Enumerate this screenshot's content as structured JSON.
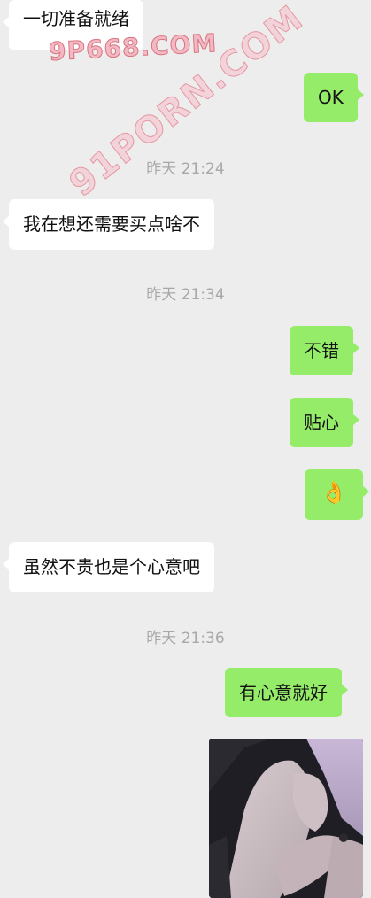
{
  "messages": [
    {
      "side": "in",
      "text": "一切准备就绪"
    },
    {
      "side": "out",
      "text": "OK"
    },
    {
      "timestamp": "昨天 21:24"
    },
    {
      "side": "in",
      "text": "我在想还需要买点啥不"
    },
    {
      "timestamp": "昨天 21:34"
    },
    {
      "side": "out",
      "text": "不错"
    },
    {
      "side": "out",
      "text": "贴心"
    },
    {
      "side": "out",
      "emoji": "ok-hand-emoji",
      "text": "👌"
    },
    {
      "side": "in",
      "text": "虽然不贵也是个心意吧"
    },
    {
      "timestamp": "昨天 21:36"
    },
    {
      "side": "out",
      "text": "有心意就好"
    },
    {
      "side": "out",
      "image": "photo-message"
    }
  ],
  "watermarks": {
    "top": "9P668.COM",
    "diagonal": "91PORN.COM"
  },
  "colors": {
    "background": "#ededed",
    "incoming_bubble": "#ffffff",
    "outgoing_bubble": "#95ec69",
    "timestamp_text": "#a8a8a8",
    "watermark": "#f2b9c4"
  }
}
